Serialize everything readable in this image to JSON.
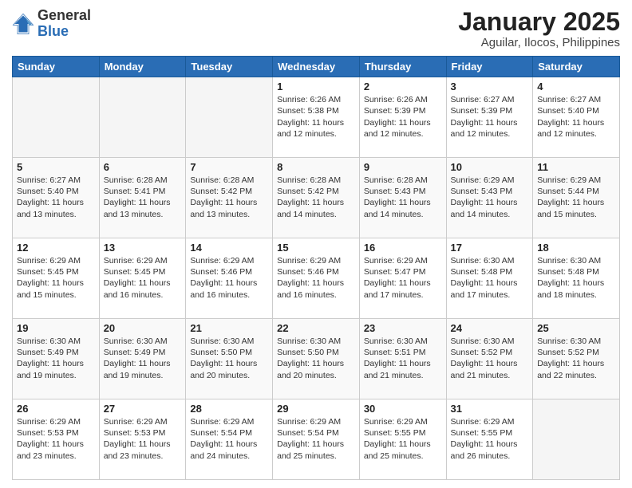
{
  "logo": {
    "general": "General",
    "blue": "Blue"
  },
  "title": {
    "month": "January 2025",
    "location": "Aguilar, Ilocos, Philippines"
  },
  "days_of_week": [
    "Sunday",
    "Monday",
    "Tuesday",
    "Wednesday",
    "Thursday",
    "Friday",
    "Saturday"
  ],
  "weeks": [
    [
      {
        "day": "",
        "empty": true
      },
      {
        "day": "",
        "empty": true
      },
      {
        "day": "",
        "empty": true
      },
      {
        "day": "1",
        "sunrise": "6:26 AM",
        "sunset": "5:38 PM",
        "daylight": "11 hours and 12 minutes."
      },
      {
        "day": "2",
        "sunrise": "6:26 AM",
        "sunset": "5:39 PM",
        "daylight": "11 hours and 12 minutes."
      },
      {
        "day": "3",
        "sunrise": "6:27 AM",
        "sunset": "5:39 PM",
        "daylight": "11 hours and 12 minutes."
      },
      {
        "day": "4",
        "sunrise": "6:27 AM",
        "sunset": "5:40 PM",
        "daylight": "11 hours and 12 minutes."
      }
    ],
    [
      {
        "day": "5",
        "sunrise": "6:27 AM",
        "sunset": "5:40 PM",
        "daylight": "11 hours and 13 minutes."
      },
      {
        "day": "6",
        "sunrise": "6:28 AM",
        "sunset": "5:41 PM",
        "daylight": "11 hours and 13 minutes."
      },
      {
        "day": "7",
        "sunrise": "6:28 AM",
        "sunset": "5:42 PM",
        "daylight": "11 hours and 13 minutes."
      },
      {
        "day": "8",
        "sunrise": "6:28 AM",
        "sunset": "5:42 PM",
        "daylight": "11 hours and 14 minutes."
      },
      {
        "day": "9",
        "sunrise": "6:28 AM",
        "sunset": "5:43 PM",
        "daylight": "11 hours and 14 minutes."
      },
      {
        "day": "10",
        "sunrise": "6:29 AM",
        "sunset": "5:43 PM",
        "daylight": "11 hours and 14 minutes."
      },
      {
        "day": "11",
        "sunrise": "6:29 AM",
        "sunset": "5:44 PM",
        "daylight": "11 hours and 15 minutes."
      }
    ],
    [
      {
        "day": "12",
        "sunrise": "6:29 AM",
        "sunset": "5:45 PM",
        "daylight": "11 hours and 15 minutes."
      },
      {
        "day": "13",
        "sunrise": "6:29 AM",
        "sunset": "5:45 PM",
        "daylight": "11 hours and 16 minutes."
      },
      {
        "day": "14",
        "sunrise": "6:29 AM",
        "sunset": "5:46 PM",
        "daylight": "11 hours and 16 minutes."
      },
      {
        "day": "15",
        "sunrise": "6:29 AM",
        "sunset": "5:46 PM",
        "daylight": "11 hours and 16 minutes."
      },
      {
        "day": "16",
        "sunrise": "6:29 AM",
        "sunset": "5:47 PM",
        "daylight": "11 hours and 17 minutes."
      },
      {
        "day": "17",
        "sunrise": "6:30 AM",
        "sunset": "5:48 PM",
        "daylight": "11 hours and 17 minutes."
      },
      {
        "day": "18",
        "sunrise": "6:30 AM",
        "sunset": "5:48 PM",
        "daylight": "11 hours and 18 minutes."
      }
    ],
    [
      {
        "day": "19",
        "sunrise": "6:30 AM",
        "sunset": "5:49 PM",
        "daylight": "11 hours and 19 minutes."
      },
      {
        "day": "20",
        "sunrise": "6:30 AM",
        "sunset": "5:49 PM",
        "daylight": "11 hours and 19 minutes."
      },
      {
        "day": "21",
        "sunrise": "6:30 AM",
        "sunset": "5:50 PM",
        "daylight": "11 hours and 20 minutes."
      },
      {
        "day": "22",
        "sunrise": "6:30 AM",
        "sunset": "5:50 PM",
        "daylight": "11 hours and 20 minutes."
      },
      {
        "day": "23",
        "sunrise": "6:30 AM",
        "sunset": "5:51 PM",
        "daylight": "11 hours and 21 minutes."
      },
      {
        "day": "24",
        "sunrise": "6:30 AM",
        "sunset": "5:52 PM",
        "daylight": "11 hours and 21 minutes."
      },
      {
        "day": "25",
        "sunrise": "6:30 AM",
        "sunset": "5:52 PM",
        "daylight": "11 hours and 22 minutes."
      }
    ],
    [
      {
        "day": "26",
        "sunrise": "6:29 AM",
        "sunset": "5:53 PM",
        "daylight": "11 hours and 23 minutes."
      },
      {
        "day": "27",
        "sunrise": "6:29 AM",
        "sunset": "5:53 PM",
        "daylight": "11 hours and 23 minutes."
      },
      {
        "day": "28",
        "sunrise": "6:29 AM",
        "sunset": "5:54 PM",
        "daylight": "11 hours and 24 minutes."
      },
      {
        "day": "29",
        "sunrise": "6:29 AM",
        "sunset": "5:54 PM",
        "daylight": "11 hours and 25 minutes."
      },
      {
        "day": "30",
        "sunrise": "6:29 AM",
        "sunset": "5:55 PM",
        "daylight": "11 hours and 25 minutes."
      },
      {
        "day": "31",
        "sunrise": "6:29 AM",
        "sunset": "5:55 PM",
        "daylight": "11 hours and 26 minutes."
      },
      {
        "day": "",
        "empty": true
      }
    ]
  ],
  "labels": {
    "sunrise": "Sunrise:",
    "sunset": "Sunset:",
    "daylight": "Daylight:"
  }
}
